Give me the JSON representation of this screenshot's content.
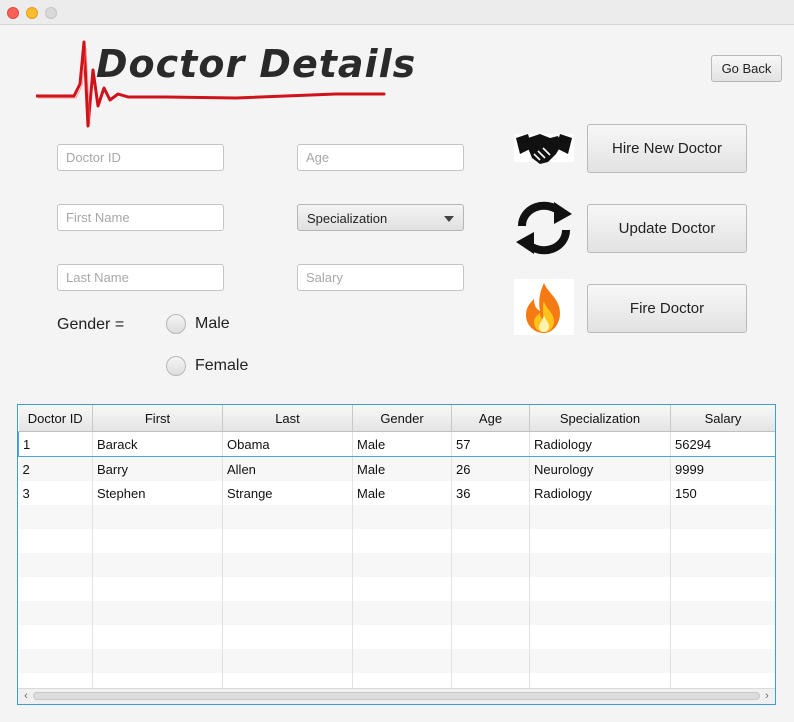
{
  "window": {
    "title": ""
  },
  "header": {
    "title": "Doctor Details",
    "go_back_label": "Go Back"
  },
  "form": {
    "doctor_id": {
      "placeholder": "Doctor ID",
      "value": ""
    },
    "first_name": {
      "placeholder": "First Name",
      "value": ""
    },
    "last_name": {
      "placeholder": "Last Name",
      "value": ""
    },
    "age": {
      "placeholder": "Age",
      "value": ""
    },
    "specialization": {
      "selected": "Specialization"
    },
    "salary": {
      "placeholder": "Salary",
      "value": ""
    },
    "gender_label": "Gender =",
    "gender_options": [
      "Male",
      "Female"
    ]
  },
  "actions": {
    "hire_label": "Hire New Doctor",
    "update_label": "Update Doctor",
    "fire_label": "Fire Doctor"
  },
  "table": {
    "columns": [
      "Doctor ID",
      "First",
      "Last",
      "Gender",
      "Age",
      "Specialization",
      "Salary"
    ],
    "rows": [
      [
        "1",
        "Barack",
        "Obama",
        "Male",
        "57",
        "Radiology",
        "56294"
      ],
      [
        "2",
        "Barry",
        "Allen",
        "Male",
        "26",
        "Neurology",
        "9999"
      ],
      [
        "3",
        "Stephen",
        "Strange",
        "Male",
        "36",
        "Radiology",
        "150"
      ]
    ],
    "selected_row": 0
  },
  "icons": {
    "handshake": "handshake-icon",
    "refresh": "refresh-icon",
    "fire": "fire-icon",
    "heartbeat": "heartbeat-icon"
  },
  "colors": {
    "accent": "#3b9ed8",
    "logo_red": "#d0121b",
    "fire_orange": "#f57a14"
  }
}
